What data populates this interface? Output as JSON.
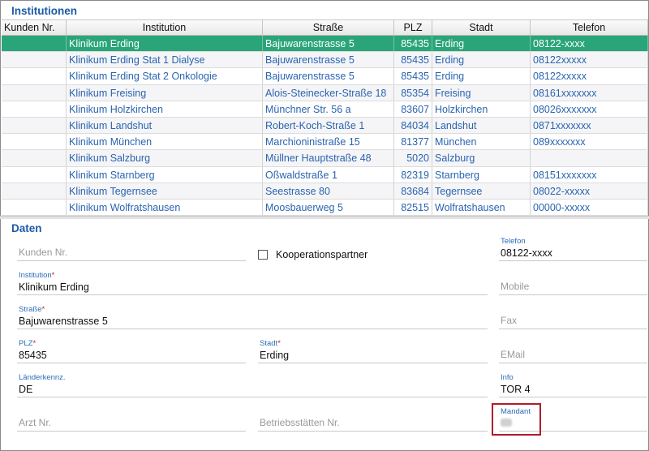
{
  "institutionen": {
    "title": "Institutionen",
    "columns": [
      "Kunden Nr.",
      "Institution",
      "Straße",
      "PLZ",
      "Stadt",
      "Telefon"
    ],
    "rows": [
      {
        "kunden_nr": "",
        "institution": "Klinikum Erding",
        "strasse": "Bajuwarenstrasse 5",
        "plz": "85435",
        "stadt": "Erding",
        "telefon": "08122-xxxx",
        "selected": true
      },
      {
        "kunden_nr": "",
        "institution": "Klinikum Erding Stat 1 Dialyse",
        "strasse": "Bajuwarenstrasse 5",
        "plz": "85435",
        "stadt": "Erding",
        "telefon": "08122xxxxx"
      },
      {
        "kunden_nr": "",
        "institution": "Klinikum Erding Stat 2 Onkologie",
        "strasse": "Bajuwarenstrasse 5",
        "plz": "85435",
        "stadt": "Erding",
        "telefon": "08122xxxxx"
      },
      {
        "kunden_nr": "",
        "institution": "Klinikum Freising",
        "strasse": "Alois-Steinecker-Straße 18",
        "plz": "85354",
        "stadt": "Freising",
        "telefon": "08161xxxxxxx"
      },
      {
        "kunden_nr": "",
        "institution": "Klinikum Holzkirchen",
        "strasse": "Münchner Str. 56 a",
        "plz": "83607",
        "stadt": "Holzkirchen",
        "telefon": "08026xxxxxxx"
      },
      {
        "kunden_nr": "",
        "institution": "Klinikum Landshut",
        "strasse": "Robert-Koch-Straße 1",
        "plz": "84034",
        "stadt": "Landshut",
        "telefon": "0871xxxxxxx"
      },
      {
        "kunden_nr": "",
        "institution": "Klinikum München",
        "strasse": "Marchioninistraße 15",
        "plz": "81377",
        "stadt": "München",
        "telefon": "089xxxxxxx"
      },
      {
        "kunden_nr": "",
        "institution": "Klinikum Salzburg",
        "strasse": "Müllner Hauptstraße 48",
        "plz": "5020",
        "stadt": "Salzburg",
        "telefon": ""
      },
      {
        "kunden_nr": "",
        "institution": "Klinikum Starnberg",
        "strasse": "Oßwaldstraße 1",
        "plz": "82319",
        "stadt": "Starnberg",
        "telefon": "08151xxxxxxx"
      },
      {
        "kunden_nr": "",
        "institution": "Klinikum Tegernsee",
        "strasse": "Seestrasse 80",
        "plz": "83684",
        "stadt": "Tegernsee",
        "telefon": "08022-xxxxx"
      },
      {
        "kunden_nr": "",
        "institution": "Klinikum Wolfratshausen",
        "strasse": "Moosbauerweg 5",
        "plz": "82515",
        "stadt": "Wolfratshausen",
        "telefon": "00000-xxxxx"
      }
    ]
  },
  "daten": {
    "title": "Daten",
    "kunden_nr": {
      "placeholder": "Kunden Nr.",
      "value": ""
    },
    "kooperationspartner": {
      "label": "Kooperationspartner",
      "checked": false
    },
    "telefon": {
      "label": "Telefon",
      "value": "08122-xxxx"
    },
    "institution": {
      "label": "Institution",
      "value": "Klinikum Erding",
      "required": "*"
    },
    "mobile": {
      "placeholder": "Mobile",
      "value": ""
    },
    "strasse": {
      "label": "Straße",
      "value": "Bajuwarenstrasse 5",
      "required": "*"
    },
    "fax": {
      "placeholder": "Fax",
      "value": ""
    },
    "plz": {
      "label": "PLZ",
      "value": "85435",
      "required": "*"
    },
    "stadt": {
      "label": "Stadt",
      "value": "Erding",
      "required": "*"
    },
    "email": {
      "placeholder": "EMail",
      "value": ""
    },
    "laenderkennz": {
      "label": "Länderkennz.",
      "value": "DE"
    },
    "info": {
      "label": "Info",
      "value": "TOR 4"
    },
    "arzt_nr": {
      "placeholder": "Arzt Nr.",
      "value": ""
    },
    "betriebsstaetten_nr": {
      "placeholder": "Betriebsstätten Nr.",
      "value": ""
    },
    "mandant": {
      "label": "Mandant"
    }
  },
  "colors": {
    "selected_row": "#2aa57a",
    "link_text": "#2a64b0",
    "label_blue": "#2a6cb8",
    "highlight_border": "#b31b2c"
  }
}
